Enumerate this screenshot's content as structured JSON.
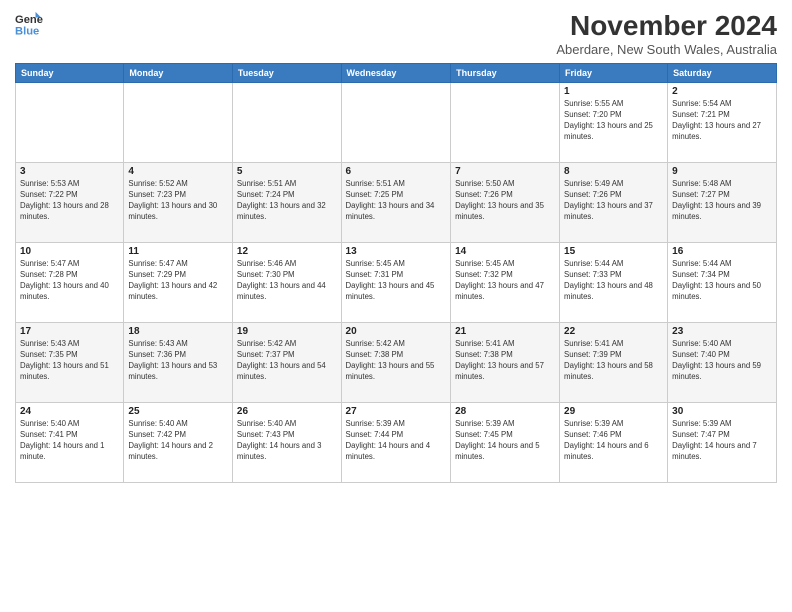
{
  "header": {
    "logo": {
      "line1": "General",
      "line2": "Blue"
    },
    "title": "November 2024",
    "location": "Aberdare, New South Wales, Australia"
  },
  "days_of_week": [
    "Sunday",
    "Monday",
    "Tuesday",
    "Wednesday",
    "Thursday",
    "Friday",
    "Saturday"
  ],
  "weeks": [
    [
      {
        "day": "",
        "info": ""
      },
      {
        "day": "",
        "info": ""
      },
      {
        "day": "",
        "info": ""
      },
      {
        "day": "",
        "info": ""
      },
      {
        "day": "",
        "info": ""
      },
      {
        "day": "1",
        "info": "Sunrise: 5:55 AM\nSunset: 7:20 PM\nDaylight: 13 hours and 25 minutes."
      },
      {
        "day": "2",
        "info": "Sunrise: 5:54 AM\nSunset: 7:21 PM\nDaylight: 13 hours and 27 minutes."
      }
    ],
    [
      {
        "day": "3",
        "info": "Sunrise: 5:53 AM\nSunset: 7:22 PM\nDaylight: 13 hours and 28 minutes."
      },
      {
        "day": "4",
        "info": "Sunrise: 5:52 AM\nSunset: 7:23 PM\nDaylight: 13 hours and 30 minutes."
      },
      {
        "day": "5",
        "info": "Sunrise: 5:51 AM\nSunset: 7:24 PM\nDaylight: 13 hours and 32 minutes."
      },
      {
        "day": "6",
        "info": "Sunrise: 5:51 AM\nSunset: 7:25 PM\nDaylight: 13 hours and 34 minutes."
      },
      {
        "day": "7",
        "info": "Sunrise: 5:50 AM\nSunset: 7:26 PM\nDaylight: 13 hours and 35 minutes."
      },
      {
        "day": "8",
        "info": "Sunrise: 5:49 AM\nSunset: 7:26 PM\nDaylight: 13 hours and 37 minutes."
      },
      {
        "day": "9",
        "info": "Sunrise: 5:48 AM\nSunset: 7:27 PM\nDaylight: 13 hours and 39 minutes."
      }
    ],
    [
      {
        "day": "10",
        "info": "Sunrise: 5:47 AM\nSunset: 7:28 PM\nDaylight: 13 hours and 40 minutes."
      },
      {
        "day": "11",
        "info": "Sunrise: 5:47 AM\nSunset: 7:29 PM\nDaylight: 13 hours and 42 minutes."
      },
      {
        "day": "12",
        "info": "Sunrise: 5:46 AM\nSunset: 7:30 PM\nDaylight: 13 hours and 44 minutes."
      },
      {
        "day": "13",
        "info": "Sunrise: 5:45 AM\nSunset: 7:31 PM\nDaylight: 13 hours and 45 minutes."
      },
      {
        "day": "14",
        "info": "Sunrise: 5:45 AM\nSunset: 7:32 PM\nDaylight: 13 hours and 47 minutes."
      },
      {
        "day": "15",
        "info": "Sunrise: 5:44 AM\nSunset: 7:33 PM\nDaylight: 13 hours and 48 minutes."
      },
      {
        "day": "16",
        "info": "Sunrise: 5:44 AM\nSunset: 7:34 PM\nDaylight: 13 hours and 50 minutes."
      }
    ],
    [
      {
        "day": "17",
        "info": "Sunrise: 5:43 AM\nSunset: 7:35 PM\nDaylight: 13 hours and 51 minutes."
      },
      {
        "day": "18",
        "info": "Sunrise: 5:43 AM\nSunset: 7:36 PM\nDaylight: 13 hours and 53 minutes."
      },
      {
        "day": "19",
        "info": "Sunrise: 5:42 AM\nSunset: 7:37 PM\nDaylight: 13 hours and 54 minutes."
      },
      {
        "day": "20",
        "info": "Sunrise: 5:42 AM\nSunset: 7:38 PM\nDaylight: 13 hours and 55 minutes."
      },
      {
        "day": "21",
        "info": "Sunrise: 5:41 AM\nSunset: 7:38 PM\nDaylight: 13 hours and 57 minutes."
      },
      {
        "day": "22",
        "info": "Sunrise: 5:41 AM\nSunset: 7:39 PM\nDaylight: 13 hours and 58 minutes."
      },
      {
        "day": "23",
        "info": "Sunrise: 5:40 AM\nSunset: 7:40 PM\nDaylight: 13 hours and 59 minutes."
      }
    ],
    [
      {
        "day": "24",
        "info": "Sunrise: 5:40 AM\nSunset: 7:41 PM\nDaylight: 14 hours and 1 minute."
      },
      {
        "day": "25",
        "info": "Sunrise: 5:40 AM\nSunset: 7:42 PM\nDaylight: 14 hours and 2 minutes."
      },
      {
        "day": "26",
        "info": "Sunrise: 5:40 AM\nSunset: 7:43 PM\nDaylight: 14 hours and 3 minutes."
      },
      {
        "day": "27",
        "info": "Sunrise: 5:39 AM\nSunset: 7:44 PM\nDaylight: 14 hours and 4 minutes."
      },
      {
        "day": "28",
        "info": "Sunrise: 5:39 AM\nSunset: 7:45 PM\nDaylight: 14 hours and 5 minutes."
      },
      {
        "day": "29",
        "info": "Sunrise: 5:39 AM\nSunset: 7:46 PM\nDaylight: 14 hours and 6 minutes."
      },
      {
        "day": "30",
        "info": "Sunrise: 5:39 AM\nSunset: 7:47 PM\nDaylight: 14 hours and 7 minutes."
      }
    ]
  ]
}
